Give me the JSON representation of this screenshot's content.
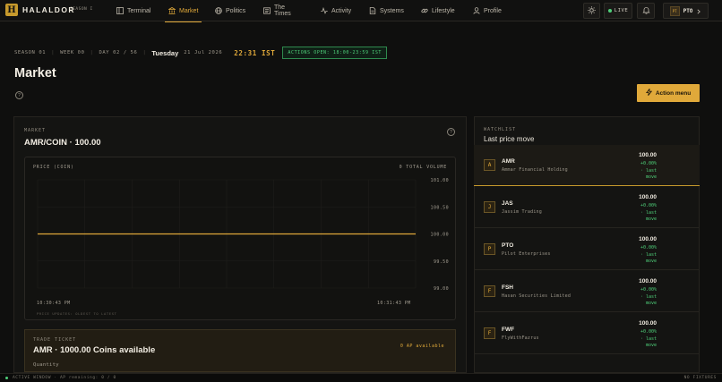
{
  "app": {
    "brand": "HALALDOR",
    "logo_letter": "H",
    "season_tag": "SEASON I"
  },
  "nav": [
    {
      "label": "Terminal",
      "icon": "terminal-icon",
      "active": false
    },
    {
      "label": "Market",
      "icon": "bank-icon",
      "active": true
    },
    {
      "label": "Politics",
      "icon": "globe-icon",
      "active": false
    },
    {
      "label": "The Times",
      "icon": "newspaper-icon",
      "active": false
    },
    {
      "label": "Activity",
      "icon": "activity-icon",
      "active": false
    },
    {
      "label": "Systems",
      "icon": "document-icon",
      "active": false
    },
    {
      "label": "Lifestyle",
      "icon": "link-icon",
      "active": false
    },
    {
      "label": "Profile",
      "icon": "user-icon",
      "active": false
    }
  ],
  "topright": {
    "live_label": "LIVE",
    "user_initials": "PT",
    "user_code": "PTO"
  },
  "header": {
    "season": "SEASON 01",
    "week": "WEEK 00",
    "day": "DAY 02 / 56",
    "day_name": "Tuesday",
    "date": "21 Jul 2026",
    "clock": "22:31 IST",
    "actions_open": "ACTIONS OPEN: 18:00-23:59 IST",
    "page_title": "Market",
    "action_menu": "Action menu"
  },
  "market": {
    "section_label": "MARKET",
    "pair": "AMR/COIN · 100.00",
    "chart_title": "PRICE (COIN)",
    "volume_label": "0 TOTAL VOLUME",
    "updates_note": "PRICE UPDATES: OLDEST TO LATEST"
  },
  "chart_data": {
    "type": "line",
    "title": "PRICE (COIN)",
    "x": [
      "10:30:43 PM",
      "10:31:43 PM"
    ],
    "series": [
      {
        "values": [
          100.0,
          100.0
        ]
      }
    ],
    "y_ticks": [
      "101.00",
      "100.50",
      "100.00",
      "99.50",
      "99.00"
    ],
    "ylim": [
      99.0,
      101.0
    ],
    "x_tick_labels": [
      "10:30:43 PM",
      "10:31:43 PM"
    ],
    "grid": true,
    "line_color": "#e0a93a"
  },
  "ticket": {
    "label": "TRADE TICKET",
    "title": "AMR · 1000.00 Coins available",
    "ap_available": "0 AP available",
    "quantity_label": "Quantity"
  },
  "watchlist": {
    "label": "WATCHLIST",
    "subtitle": "Last price move",
    "items": [
      {
        "badge": "A",
        "symbol": "AMR",
        "name": "Ammar Financial Holding",
        "price": "100.00",
        "change": "+0.00%",
        "change_note1": "· last",
        "change_note2": "move",
        "selected": true
      },
      {
        "badge": "J",
        "symbol": "JAS",
        "name": "Jassim Trading",
        "price": "100.00",
        "change": "+0.00%",
        "change_note1": "· last",
        "change_note2": "move",
        "selected": false
      },
      {
        "badge": "P",
        "symbol": "PTO",
        "name": "Pilot Enterprises",
        "price": "100.00",
        "change": "+0.00%",
        "change_note1": "· last",
        "change_note2": "move",
        "selected": false
      },
      {
        "badge": "F",
        "symbol": "FSH",
        "name": "Hasan Securities Limited",
        "price": "100.00",
        "change": "+0.00%",
        "change_note1": "· last",
        "change_note2": "move",
        "selected": false
      },
      {
        "badge": "F",
        "symbol": "FWF",
        "name": "FlyWithFazrus",
        "price": "100.00",
        "change": "+0.00%",
        "change_note1": "· last",
        "change_note2": "move",
        "selected": false
      }
    ]
  },
  "footer": {
    "left": "ACTIVE WINDOW · AP remaining: 0 / 0",
    "right": "NO FIXTURES"
  },
  "colors": {
    "accent": "#e0a93a",
    "positive": "#4fd07a",
    "background": "#0f0f0e"
  }
}
